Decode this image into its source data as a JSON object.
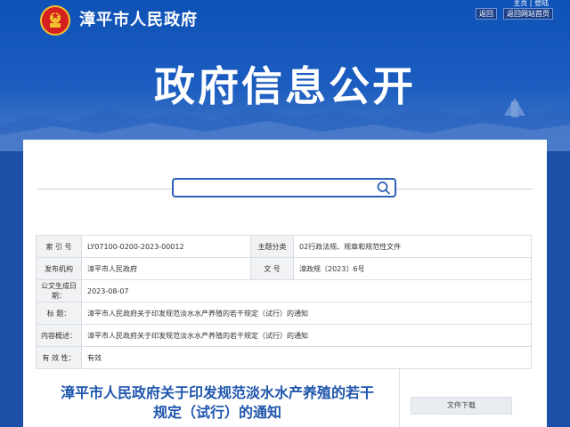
{
  "header": {
    "site_name": "漳平市人民政府",
    "top_links": "主页 | 登陆",
    "back_label": "返回",
    "home_label": "返回网站首页",
    "hero_title": "政府信息公开"
  },
  "search": {
    "placeholder": ""
  },
  "info": {
    "index_label": "索 引 号",
    "index_value": "LY07100-0200-2023-00012",
    "category_label": "主题分类",
    "category_value": "02行政法规、规章和规范性文件",
    "issuer_label": "发布机构",
    "issuer_value": "漳平市人民政府",
    "doc_no_label": "文  号",
    "doc_no_value": "漳政规〔2023〕6号",
    "date_label": "公文生成日期：",
    "date_value": "2023-08-07",
    "title_label": "标   题：",
    "title_value": "漳平市人民政府关于印发规范淡水水产养殖的若干规定（试行）的通知",
    "summary_label": "内容概述：",
    "summary_value": "漳平市人民政府关于印发规范淡水水产养殖的若干规定（试行）的通知",
    "validity_label": "有 效 性：",
    "validity_value": "有效"
  },
  "document": {
    "title_line1": "漳平市人民政府关于印发规范淡水水产养殖的若干",
    "title_line2": "规定（试行）的通知",
    "download_label": "文件下载"
  },
  "colors": {
    "brand_blue": "#1f56ad",
    "hero_blue": "#0f52b5"
  }
}
